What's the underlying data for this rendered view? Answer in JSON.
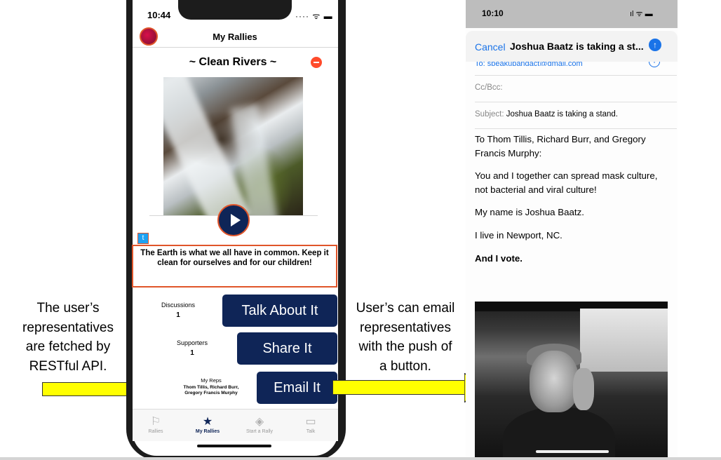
{
  "annotations": {
    "left_note": [
      "The user’s",
      "representatives",
      "are fetched by",
      "RESTful API."
    ],
    "right_note": [
      "User’s can email",
      "representatives",
      "with the push of",
      "a button."
    ]
  },
  "phone": {
    "status_time": "10:44",
    "status_icons": "···· ᯤ ▬",
    "nav_title": "My Rallies",
    "rally_title": "~ Clean Rivers ~",
    "twitter_icon": "t",
    "quote": "The Earth is what we all have in common. Keep it clean for ourselves and for our children!",
    "stats": {
      "discussions_label": "Discussions",
      "discussions_value": "1",
      "supporters_label": "Supporters",
      "supporters_value": "1",
      "reps_label": "My Reps",
      "reps_value": "Thom Tillis, Richard Burr, Gregory Francis Murphy"
    },
    "buttons": {
      "talk": "Talk About It",
      "share": "Share It",
      "email": "Email It"
    },
    "tabs": [
      {
        "label": "Rallies",
        "icon": "⚐"
      },
      {
        "label": "My Rallies",
        "icon": "★"
      },
      {
        "label": "Start a Rally",
        "icon": "◈"
      },
      {
        "label": "Talk",
        "icon": "▭"
      }
    ]
  },
  "mail": {
    "status_time": "10:10",
    "status_icons": "ıl ᯤ ▬",
    "cancel": "Cancel",
    "title": "Joshua Baatz is taking a st...",
    "send_icon": "↑",
    "to_value": "To: speakupandact@gmail.com",
    "plus_icon": "+",
    "cc_label": "Cc/Bcc:",
    "subject_label": "Subject:",
    "subject_value": "Joshua Baatz is taking a stand.",
    "body": [
      "To Thom Tillis, Richard Burr, and Gregory Francis Murphy:",
      "You and I together can spread mask culture, not bacterial and viral culture!",
      "My name is Joshua Baatz.",
      "I live in Newport, NC.",
      "And I vote."
    ]
  },
  "colors": {
    "navy": "#0f2557",
    "accent_orange": "#e0552a",
    "minus_red": "#ff4b2b",
    "twitter_blue": "#1da1f2",
    "mail_blue": "#1a73e8",
    "arrow_yellow": "#ffff00"
  }
}
